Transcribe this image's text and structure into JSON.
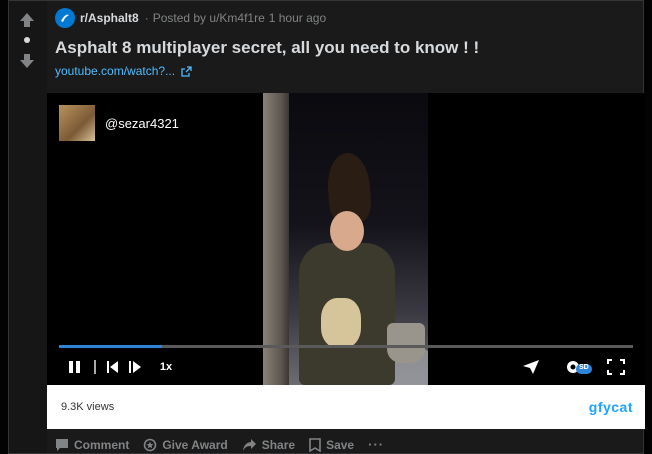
{
  "post": {
    "subreddit": "r/Asphalt8",
    "separator": "·",
    "posted_by": "Posted by u/Km4f1re",
    "time_ago": "1 hour ago",
    "title": "Asphalt 8 multiplayer secret, all you need to know ! !",
    "link_text": "youtube.com/watch?..."
  },
  "video": {
    "channel_handle": "@sezar4321",
    "progress": 0.18,
    "speed_label": "1x",
    "quality_label": "SD",
    "views": "9.3K views",
    "brand": "gfycat"
  },
  "actions": {
    "comment": "Comment",
    "give_award": "Give Award",
    "share": "Share",
    "save": "Save",
    "more": "···"
  },
  "colors": {
    "background": "#030303",
    "card": "#1a1a1b",
    "accent_link": "#4fbcff",
    "progress": "#2e84d9",
    "brand": "#1ea3ff"
  },
  "icons": [
    "upvote-icon",
    "downvote-icon",
    "subreddit-icon",
    "external-link-icon",
    "play-pause-icon",
    "previous-icon",
    "next-icon",
    "share-arrow-icon",
    "settings-gear-icon",
    "fullscreen-icon",
    "comment-icon",
    "award-icon",
    "share-icon",
    "save-icon",
    "more-icon"
  ]
}
